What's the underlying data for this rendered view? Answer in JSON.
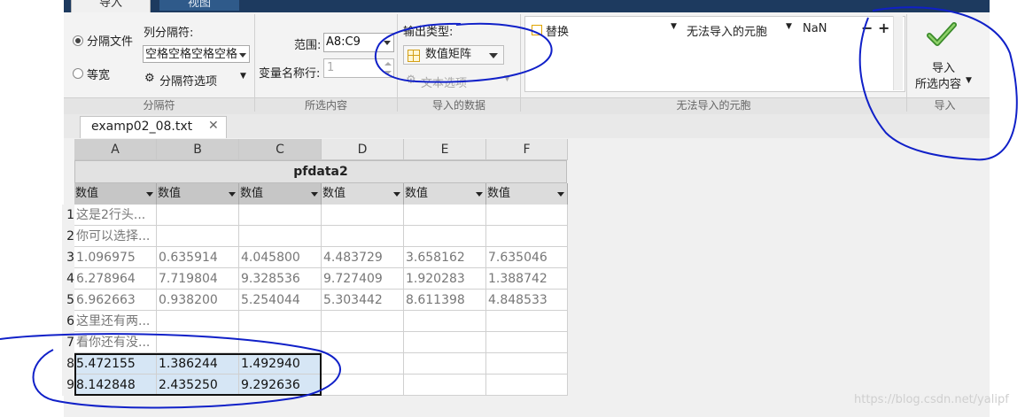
{
  "ribbon_tabs": {
    "import": "导入",
    "view": "视图"
  },
  "delimited_section": {
    "radio_delimited": "分隔文件",
    "radio_fixed_width": "等宽",
    "column_delimiter_label": "列分隔符:",
    "column_delimiter_value": "空格空格空格空格",
    "delimiter_options": "分隔符选项",
    "section_label": "分隔符"
  },
  "selection_section": {
    "range_label": "范围:",
    "range_value": "A8:C9",
    "varname_row_label": "变量名称行:",
    "varname_row_value": "1",
    "section_label": "所选内容"
  },
  "imported_data_section": {
    "output_type_label": "输出类型:",
    "output_type_value": "数值矩阵",
    "text_options": "文本选项",
    "section_label": "导入的数据"
  },
  "unimportable_section": {
    "rule_action": "替换",
    "rule_target": "无法导入的元胞",
    "rule_value": "NaN",
    "minus": "−",
    "plus": "+",
    "section_label": "无法导入的元胞"
  },
  "import_section": {
    "button_line1": "导入",
    "button_line2": "所选内容",
    "section_label": "导入"
  },
  "document_tab": {
    "filename": "examp02_08.txt",
    "close": "✕"
  },
  "sheet": {
    "title": "pfdata2",
    "columns": [
      "A",
      "B",
      "C",
      "D",
      "E",
      "F"
    ],
    "column_type": "数值",
    "row_numbers": [
      "1",
      "2",
      "3",
      "4",
      "5",
      "6",
      "7",
      "8",
      "9"
    ],
    "rows": [
      [
        "这是2行头...",
        "",
        "",
        "",
        "",
        ""
      ],
      [
        "你可以选择...",
        "",
        "",
        "",
        "",
        ""
      ],
      [
        "1.096975",
        "0.635914",
        "4.045800",
        "4.483729",
        "3.658162",
        "7.635046"
      ],
      [
        "6.278964",
        "7.719804",
        "9.328536",
        "9.727409",
        "1.920283",
        "1.388742"
      ],
      [
        "6.962663",
        "0.938200",
        "5.254044",
        "5.303442",
        "8.611398",
        "4.848533"
      ],
      [
        "这里还有两...",
        "",
        "",
        "",
        "",
        ""
      ],
      [
        "看你还有没...",
        "",
        "",
        "",
        "",
        ""
      ],
      [
        "5.472155",
        "1.386244",
        "1.492940",
        "",
        "",
        ""
      ],
      [
        "8.142848",
        "2.435250",
        "9.292636",
        "",
        "",
        ""
      ]
    ]
  },
  "watermark": "https://blog.csdn.net/yalipf",
  "colors": {
    "ribbon_bg": "#f3f3f3",
    "selection": "#d6e6f5",
    "annotation": "#1020c8"
  }
}
